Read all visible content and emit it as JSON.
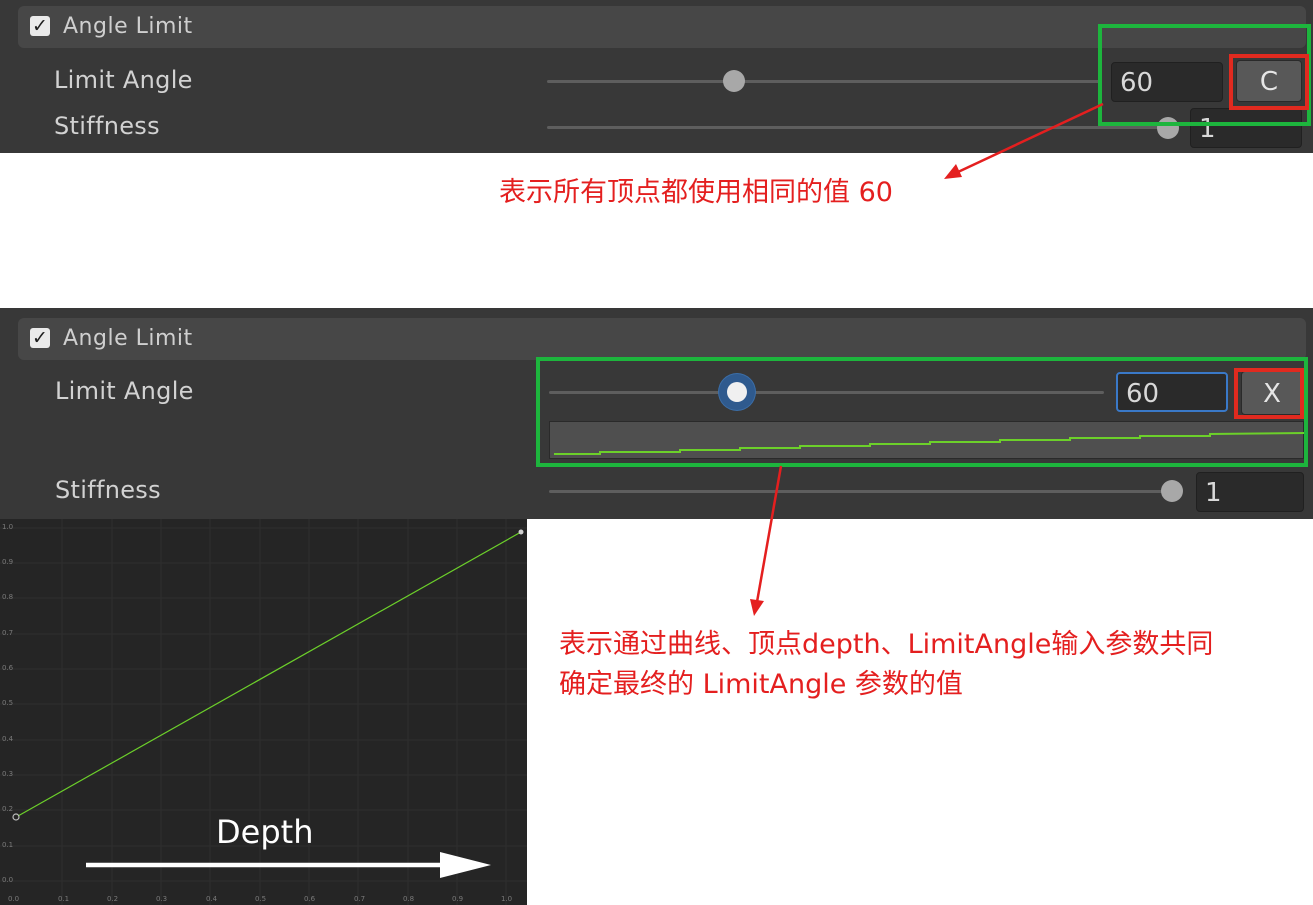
{
  "top_panel": {
    "section_title": "Angle Limit",
    "limit_angle_label": "Limit Angle",
    "limit_angle_value": "60",
    "mode_button_label": "C",
    "stiffness_label": "Stiffness",
    "stiffness_value": "1",
    "checkbox_checked": true
  },
  "top_annotation": "表示所有顶点都使用相同的值 60",
  "bottom_panel": {
    "section_title": "Angle Limit",
    "limit_angle_label": "Limit Angle",
    "limit_angle_value": "60",
    "mode_button_label": "X",
    "stiffness_label": "Stiffness",
    "stiffness_value": "1",
    "checkbox_checked": true
  },
  "bottom_annotation_line1": "表示通过曲线、顶点depth、LimitAngle输入参数共同",
  "bottom_annotation_line2": "确定最终的 LimitAngle 参数的值",
  "curve_editor": {
    "arrow_label": "Depth",
    "y_ticks": [
      "1.0",
      "0.9",
      "0.8",
      "0.7",
      "0.6",
      "0.5",
      "0.4",
      "0.3",
      "0.2",
      "0.1",
      "0.0"
    ],
    "x_ticks": [
      "0.0",
      "0.1",
      "0.2",
      "0.3",
      "0.4",
      "0.5",
      "0.6",
      "0.7",
      "0.8",
      "0.9",
      "1.0"
    ],
    "curve_start": [
      0.0,
      0.2
    ],
    "curve_end": [
      1.0,
      1.0
    ]
  },
  "colors": {
    "highlight_green": "#1db53d",
    "highlight_red": "#e12a1f",
    "annotation_red": "#e41f1f",
    "curve_green": "#6cd02a"
  }
}
